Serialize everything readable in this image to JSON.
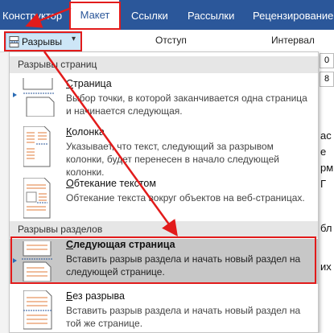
{
  "ribbon_tabs": [
    {
      "label": "Конструктор"
    },
    {
      "label": "Макет"
    },
    {
      "label": "Ссылки"
    },
    {
      "label": "Рассылки"
    },
    {
      "label": "Рецензирование"
    }
  ],
  "ribbon": {
    "breaks_label": "Разрывы",
    "indent_label": "Отступ",
    "spacing_label": "Интервал",
    "indent_value": "0",
    "spacing_value": "8"
  },
  "document_chars": [
    "ас",
    "е",
    "рм",
    "Г",
    "бл",
    "их"
  ],
  "menu": {
    "page_breaks_header": "Разрывы страниц",
    "section_breaks_header": "Разрывы разделов",
    "items": [
      {
        "title_u": "С",
        "title_rest": "траница",
        "desc": "Выбор точки, в которой заканчивается одна страница и начинается следующая."
      },
      {
        "title_u": "К",
        "title_rest": "олонка",
        "desc": "Указывает, что текст, следующий за разрывом колонки, будет перенесен в начало следующей колонки."
      },
      {
        "title_u": "О",
        "title_rest": "бтекание текстом",
        "desc": "Обтекание текста вокруг объектов на веб-страницах."
      },
      {
        "title_u": "С",
        "title_rest": "ледующая страница",
        "desc": "Вставить разрыв раздела и начать новый раздел на следующей странице."
      },
      {
        "title_u": "Б",
        "title_rest": "ез разрыва",
        "desc": "Вставить разрыв раздела и начать новый раздел на той же странице."
      }
    ]
  },
  "colors": {
    "tab_bar": "#2b579a",
    "highlight_red": "#e21b1b",
    "selected_item": "#c7c7c7"
  }
}
